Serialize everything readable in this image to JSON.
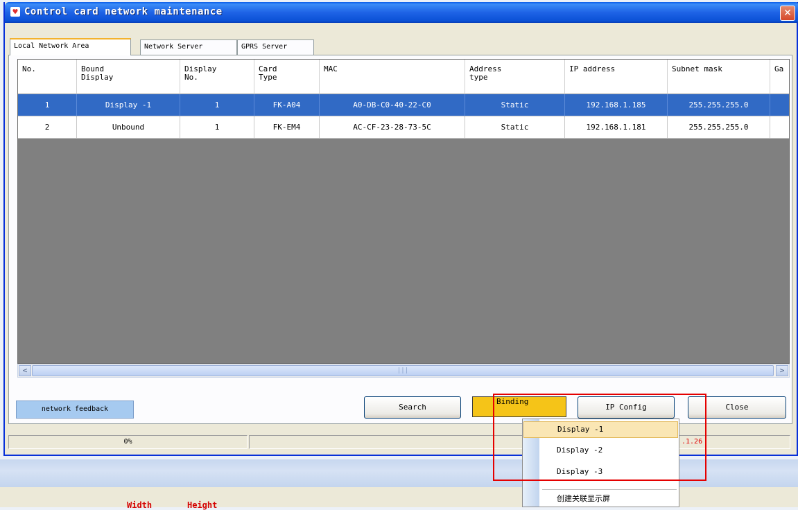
{
  "dialog": {
    "title": "Control card network maintenance",
    "app_icon": "heart-icon",
    "close_glyph": "✕"
  },
  "tabs": [
    {
      "label": "Local Network Area",
      "active": true
    },
    {
      "label": "Network Server",
      "active": false
    },
    {
      "label": "GPRS Server",
      "active": false
    }
  ],
  "grid": {
    "columns": [
      "No.",
      "Bound\nDisplay",
      "Display\nNo.",
      "Card\nType",
      "MAC",
      "Address\ntype",
      "IP address",
      "Subnet mask",
      "Ga"
    ],
    "rows": [
      {
        "no": "1",
        "bound_display": "Display -1",
        "display_no": "1",
        "card_type": "FK-A04",
        "mac": "A0-DB-C0-40-22-C0",
        "address_type": "Static",
        "ip": "192.168.1.185",
        "subnet": "255.255.255.0",
        "gateway": "",
        "selected": true
      },
      {
        "no": "2",
        "bound_display": "Unbound",
        "display_no": "1",
        "card_type": "FK-EM4",
        "mac": "AC-CF-23-28-73-5C",
        "address_type": "Static",
        "ip": "192.168.1.181",
        "subnet": "255.255.255.0",
        "gateway": "",
        "selected": false
      }
    ]
  },
  "scrollbar": {
    "left_arrow": "<",
    "right_arrow": ">",
    "thumb_grip": "|||"
  },
  "buttons": {
    "network_feedback": "network feedback",
    "search": "Search",
    "binding": "Binding",
    "ip_config": "IP Config",
    "close": "Close"
  },
  "status": {
    "progress_text": "0%",
    "ip_fragment": ".1.26"
  },
  "context_menu": {
    "items": [
      "Display -1",
      "Display -2",
      "Display -3",
      "创建关联显示屏"
    ],
    "highlighted_index": 0
  },
  "background": {
    "width_label": "Width",
    "height_label": "Height"
  },
  "colors": {
    "title_blue": "#0a5ce8",
    "selection_blue": "#316ac5",
    "binding_yellow": "#f5c418",
    "annotation_red": "#e50000",
    "unbound_red": "#e00000"
  }
}
